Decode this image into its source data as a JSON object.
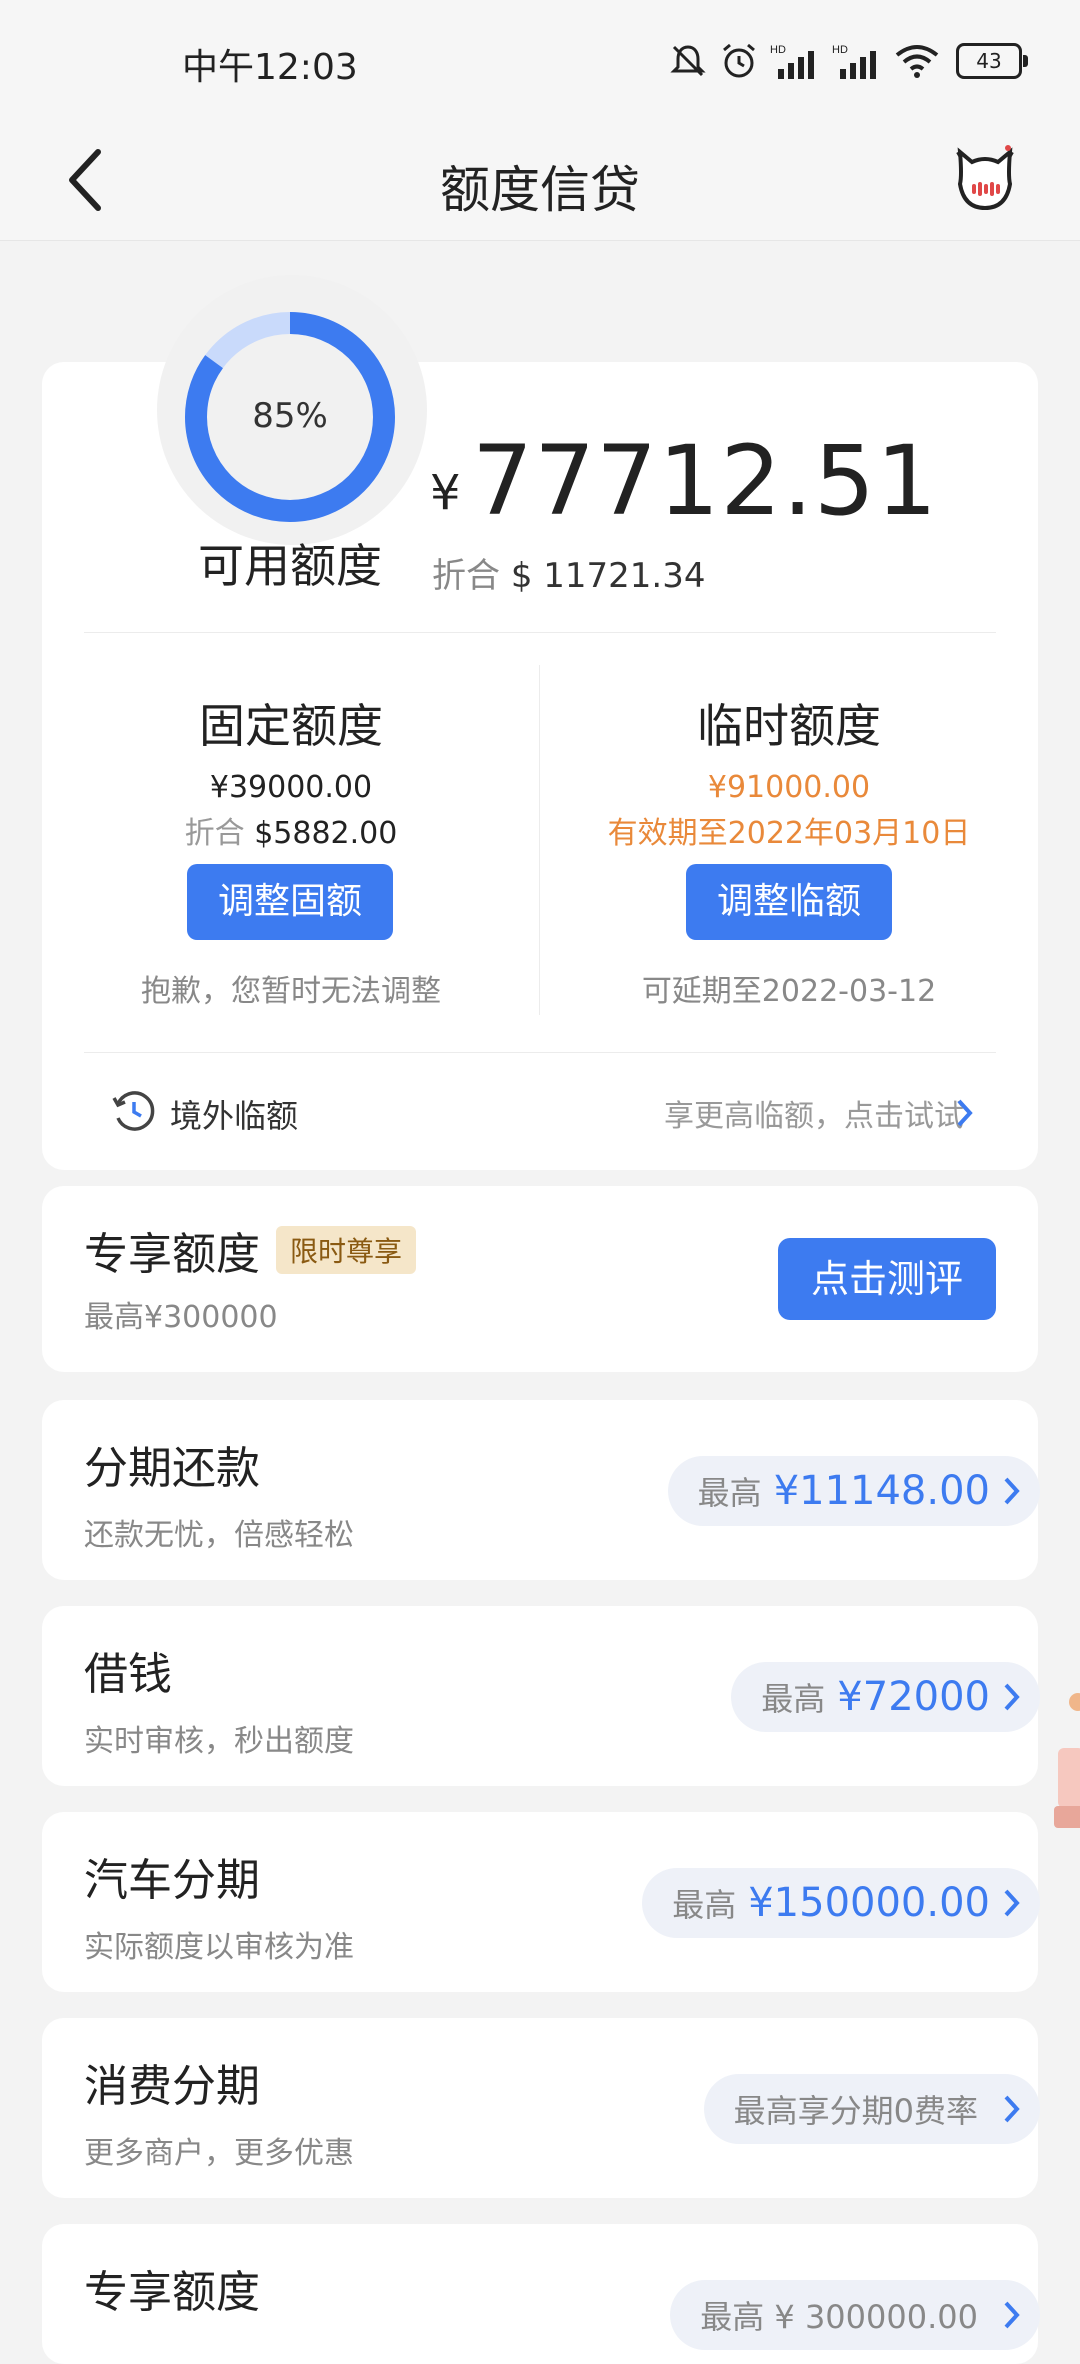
{
  "status_bar": {
    "time": "中午12:03",
    "battery": "43"
  },
  "nav": {
    "title": "额度信贷"
  },
  "summary": {
    "percent": "85%",
    "percent_value": 0.85,
    "available_label": "可用额度",
    "currency_symbol": "¥",
    "amount": "77712.51",
    "converted_label": "折合",
    "converted_value": "$ 11721.34"
  },
  "fixed": {
    "title": "固定额度",
    "amount": "¥39000.00",
    "converted_label": "折合",
    "converted_value": "$5882.00",
    "button": "调整固额",
    "note": "抱歉，您暂时无法调整"
  },
  "temporary": {
    "title": "临时额度",
    "amount": "¥91000.00",
    "validity": "有效期至2022年03月10日",
    "button": "调整临额",
    "note": "可延期至2022-03-12"
  },
  "overseas": {
    "label": "境外临额",
    "cta": "享更高临额，点击试试"
  },
  "exclusive": {
    "title": "专享额度",
    "badge": "限时尊享",
    "max": "最高¥300000",
    "button": "点击测评"
  },
  "products": [
    {
      "title": "分期还款",
      "subtitle": "还款无忧，倍感轻松",
      "label": "最高",
      "value": "¥11148.00"
    },
    {
      "title": "借钱",
      "subtitle": "实时审核，秒出额度",
      "label": "最高",
      "value": "¥72000"
    },
    {
      "title": "汽车分期",
      "subtitle": "实际额度以审核为准",
      "label": "最高",
      "value": "¥150000.00"
    },
    {
      "title": "消费分期",
      "subtitle": "更多商户，更多优惠",
      "label": "最高享分期0费率",
      "value": ""
    },
    {
      "title": "专享额度",
      "subtitle": "",
      "label": "最高 ¥ 300000.00",
      "value": ""
    }
  ],
  "colors": {
    "accent": "#3d7bf0",
    "orange": "#e9893a",
    "ring_track": "#c9dafb"
  },
  "icons": [
    "back-arrow-icon",
    "mascot-icon",
    "bell-muted-icon",
    "alarm-icon",
    "signal-icon",
    "wifi-icon",
    "battery-icon",
    "clock-refresh-icon",
    "chevron-right-icon"
  ]
}
